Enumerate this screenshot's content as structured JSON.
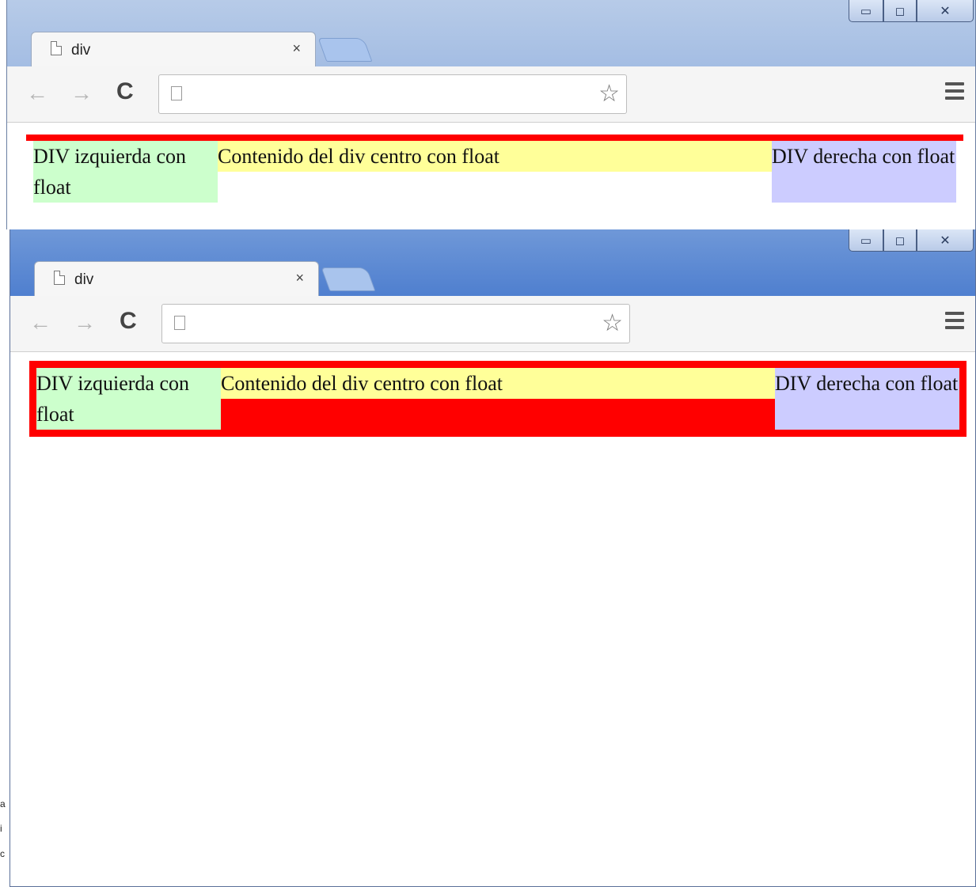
{
  "windows": [
    {
      "tab_title": "div",
      "tab_close": "×",
      "controls": {
        "min": "▭",
        "max": "◻",
        "close": "✕"
      },
      "nav": {
        "back": "←",
        "forward": "→",
        "reload": "C"
      },
      "content": {
        "left": "DIV izquierda con float",
        "center": "Contenido del div centro con float",
        "right": "DIV derecha con float"
      }
    },
    {
      "tab_title": "div",
      "tab_close": "×",
      "controls": {
        "min": "▭",
        "max": "◻",
        "close": "✕"
      },
      "nav": {
        "back": "←",
        "forward": "→",
        "reload": "C"
      },
      "content": {
        "left": "DIV izquierda con float",
        "center": "Contenido del div centro con float",
        "right": "DIV derecha con float"
      }
    }
  ],
  "colors": {
    "container": "#ff0000",
    "left": "#ccffcc",
    "center": "#ffff99",
    "right": "#ccccff"
  },
  "edge_fragments": [
    "a",
    "i",
    "c"
  ]
}
